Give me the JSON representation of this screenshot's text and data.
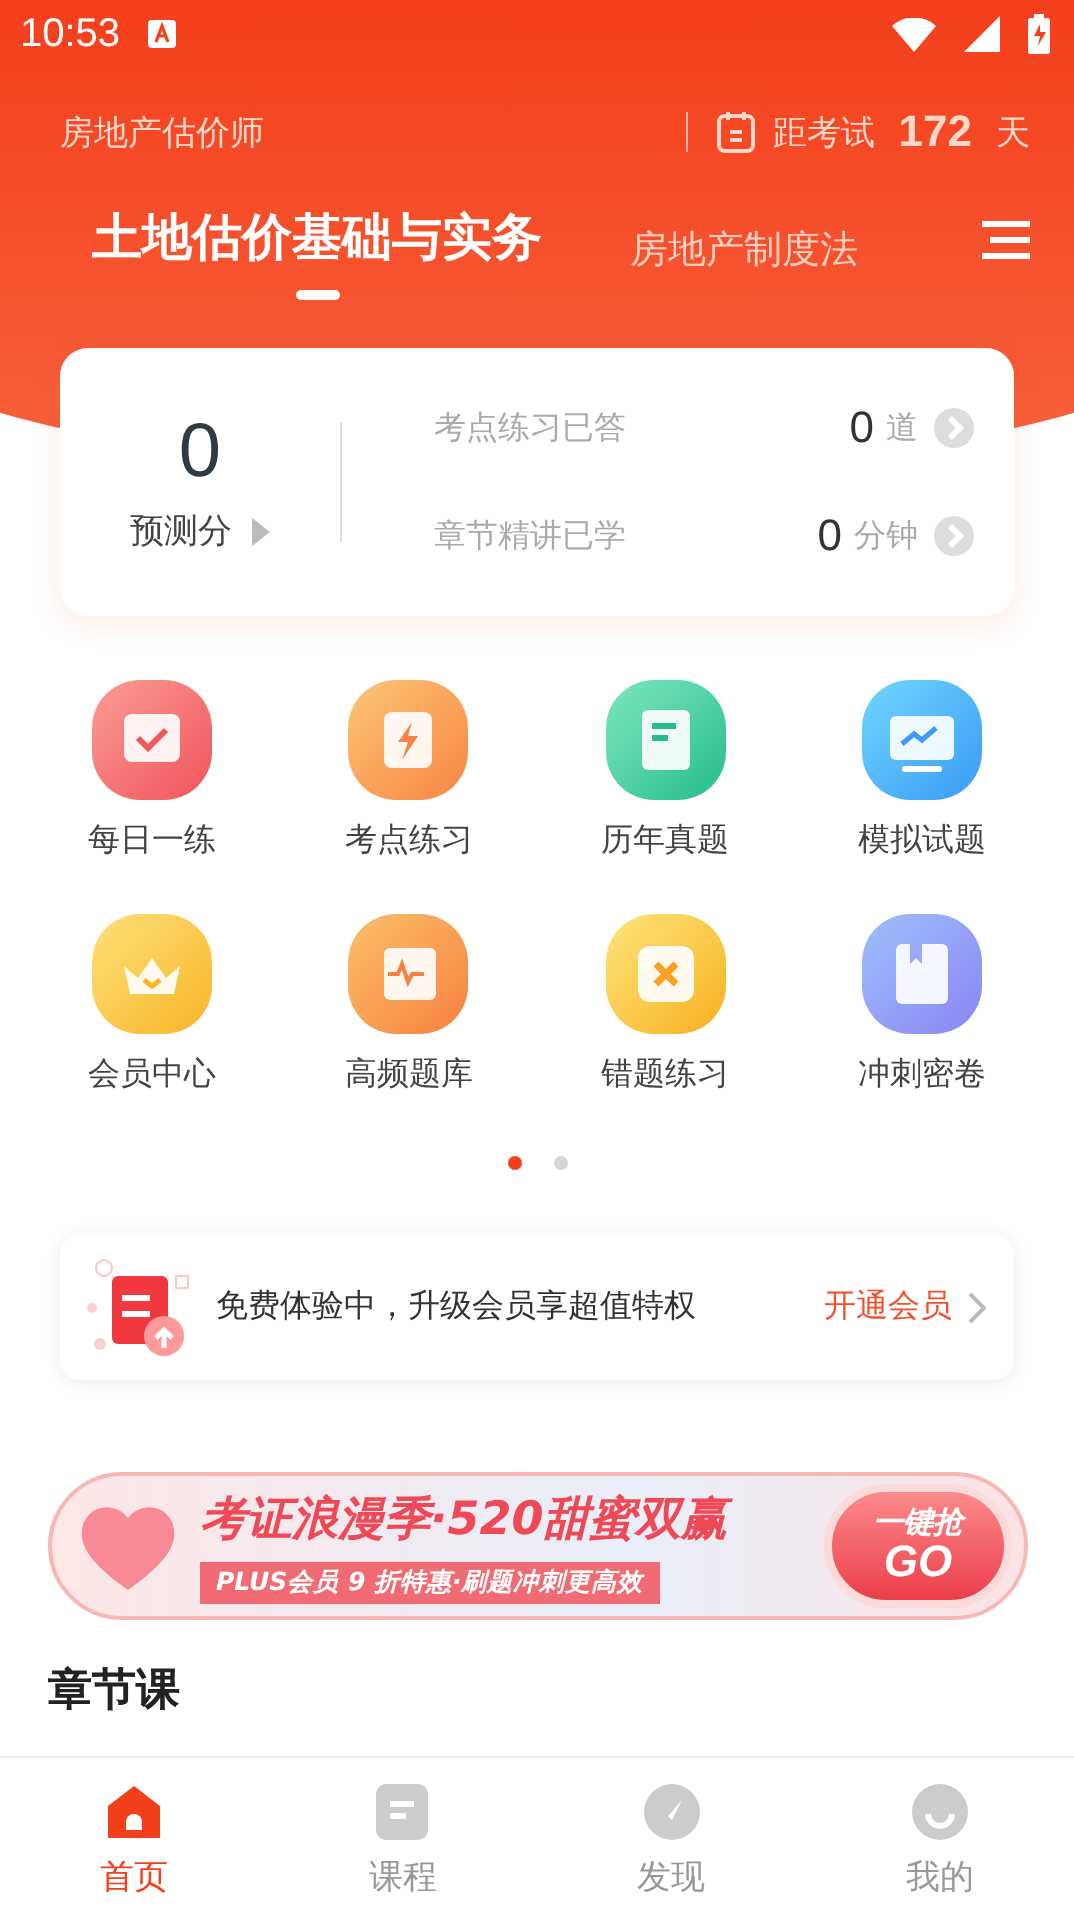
{
  "status_bar": {
    "time": "10:53"
  },
  "header": {
    "exam_name": "房地产估价师",
    "countdown_label": "距考试",
    "countdown_days": "172",
    "countdown_unit": "天"
  },
  "subject_tabs": [
    {
      "label": "土地估价基础与实务",
      "selected": true
    },
    {
      "label": "房地产制度法",
      "selected": false
    }
  ],
  "stats": {
    "score": "0",
    "score_label": "预测分",
    "rows": [
      {
        "label": "考点练习已答",
        "value": "0",
        "unit": "道"
      },
      {
        "label": "章节精讲已学",
        "value": "0",
        "unit": "分钟"
      }
    ]
  },
  "shortcuts": [
    {
      "label": "每日一练",
      "kind": "calendar"
    },
    {
      "label": "考点练习",
      "kind": "bolt"
    },
    {
      "label": "历年真题",
      "kind": "paper"
    },
    {
      "label": "模拟试题",
      "kind": "monitor"
    },
    {
      "label": "会员中心",
      "kind": "crown"
    },
    {
      "label": "高频题库",
      "kind": "pulse"
    },
    {
      "label": "错题练习",
      "kind": "cross"
    },
    {
      "label": "冲刺密卷",
      "kind": "book"
    }
  ],
  "pager": [
    {
      "selected": true
    },
    {
      "selected": false
    }
  ],
  "promo": {
    "text": "免费体验中，升级会员享超值特权",
    "action": "开通会员"
  },
  "banner": {
    "title": "考证浪漫季·520甜蜜双赢",
    "subtitle": "PLUS会员 9 折特惠·刷题冲刺更高效",
    "button_top": "一键抢",
    "button_bottom": "GO"
  },
  "section_title": "章节课",
  "bottom_nav": [
    {
      "label": "首页",
      "kind": "home",
      "selected": true
    },
    {
      "label": "课程",
      "kind": "course",
      "selected": false
    },
    {
      "label": "发现",
      "kind": "compass",
      "selected": false
    },
    {
      "label": "我的",
      "kind": "face",
      "selected": false
    }
  ]
}
